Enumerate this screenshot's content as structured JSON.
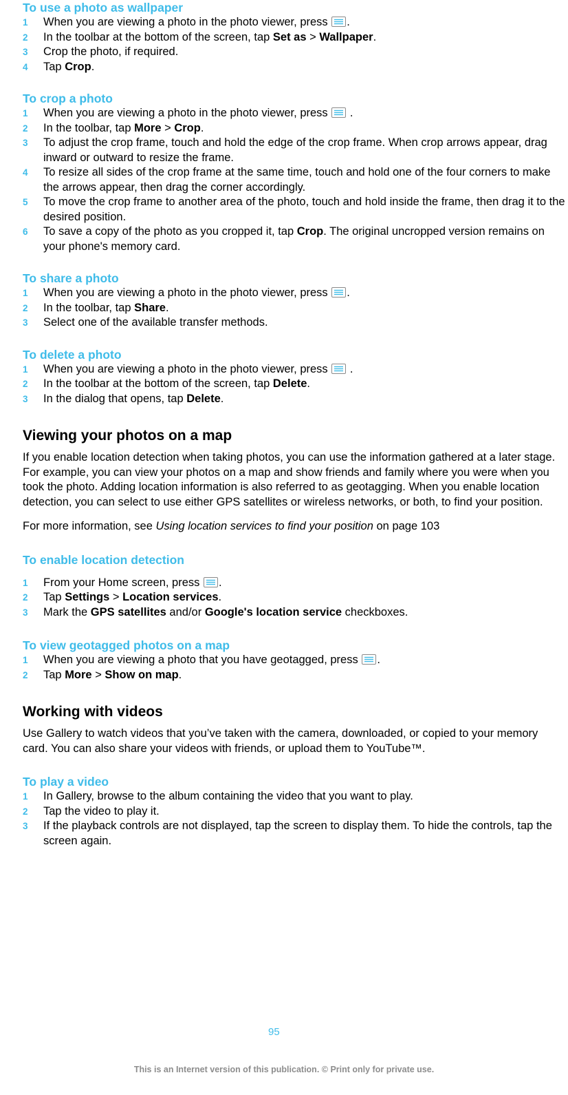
{
  "page": {
    "number": "95",
    "footer_text": "This is an Internet version of this publication. © Print only for private use."
  },
  "sections": [
    {
      "heading": "To use a photo as wallpaper",
      "steps": [
        {
          "pre": "When you are viewing a photo in the photo viewer, press ",
          "icon": "menu-icon",
          "post": "."
        },
        {
          "pre": "In the toolbar at the bottom of the screen, tap ",
          "bold1": "Set as",
          "sep": " > ",
          "bold2": "Wallpaper",
          "post": "."
        },
        {
          "pre": "Crop the photo, if required."
        },
        {
          "pre": "Tap ",
          "bold1": "Crop",
          "post": "."
        }
      ]
    },
    {
      "heading": "To crop a photo",
      "steps": [
        {
          "pre": "When you are viewing a photo in the photo viewer, press ",
          "icon": "menu-icon",
          "post": " ."
        },
        {
          "pre": "In the toolbar, tap ",
          "bold1": "More",
          "sep": " > ",
          "bold2": "Crop",
          "post": "."
        },
        {
          "pre": "To adjust the crop frame, touch and hold the edge of the crop frame. When crop arrows appear, drag inward or outward to resize the frame."
        },
        {
          "pre": "To resize all sides of the crop frame at the same time, touch and hold one of the four corners to make the arrows appear, then drag the corner accordingly."
        },
        {
          "pre": "To move the crop frame to another area of the photo, touch and hold inside the frame, then drag it to the desired position."
        },
        {
          "pre": "To save a copy of the photo as you cropped it, tap ",
          "bold1": "Crop",
          "post": ". The original uncropped version remains on your phone's memory card."
        }
      ]
    },
    {
      "heading": "To share a photo",
      "steps": [
        {
          "pre": "When you are viewing a photo in the photo viewer, press ",
          "icon": "menu-icon",
          "post": "."
        },
        {
          "pre": "In the toolbar, tap ",
          "bold1": "Share",
          "post": "."
        },
        {
          "pre": "Select one of the available transfer methods."
        }
      ]
    },
    {
      "heading": "To delete a photo",
      "steps": [
        {
          "pre": "When you are viewing a photo in the photo viewer, press ",
          "icon": "menu-icon",
          "post": " ."
        },
        {
          "pre": "In the toolbar at the bottom of the screen, tap ",
          "bold1": "Delete",
          "post": "."
        },
        {
          "pre": "In the dialog that opens, tap ",
          "bold1": "Delete",
          "post": "."
        }
      ]
    }
  ],
  "map_section": {
    "heading": "Viewing your photos on a map",
    "paragraph1": "If you enable location detection when taking photos, you can use the information gathered at a later stage. For example, you can view your photos on a map and show friends and family where you were when you took the photo. Adding location information is also referred to as geotagging. When you enable location detection, you can select to use either GPS satellites or wireless networks, or both, to find your position.",
    "paragraph2_pre": "For more information, see ",
    "paragraph2_italic": "Using location services to find your position",
    "paragraph2_post": " on page 103"
  },
  "location_section": {
    "heading": "To enable location detection",
    "steps": [
      {
        "pre": "From your Home screen, press ",
        "icon": "menu-icon",
        "post": "."
      },
      {
        "pre": "Tap ",
        "bold1": "Settings",
        "sep": " > ",
        "bold2": "Location services",
        "post": "."
      },
      {
        "pre": "Mark the ",
        "bold1": "GPS satellites",
        "sep": " and/or ",
        "bold2": "Google's location service",
        "post": " checkboxes."
      }
    ]
  },
  "geotag_section": {
    "heading": "To view geotagged photos on a map",
    "steps": [
      {
        "pre": "When you are viewing a photo that you have geotagged, press ",
        "icon": "menu-icon",
        "post": "."
      },
      {
        "pre": "Tap ",
        "bold1": "More",
        "sep": " > ",
        "bold2": "Show on map",
        "post": "."
      }
    ]
  },
  "video_section": {
    "heading": "Working with videos",
    "paragraph": "Use Gallery to watch videos that you’ve taken with the camera, downloaded, or copied to your memory card. You can also share your videos with friends, or upload them to YouTube™."
  },
  "play_section": {
    "heading": "To play a video",
    "steps": [
      {
        "pre": "In Gallery, browse to the album containing the video that you want to play."
      },
      {
        "pre": "Tap the video to play it."
      },
      {
        "pre": "If the playback controls are not displayed, tap the screen to display them. To hide the controls, tap the screen again."
      }
    ]
  }
}
